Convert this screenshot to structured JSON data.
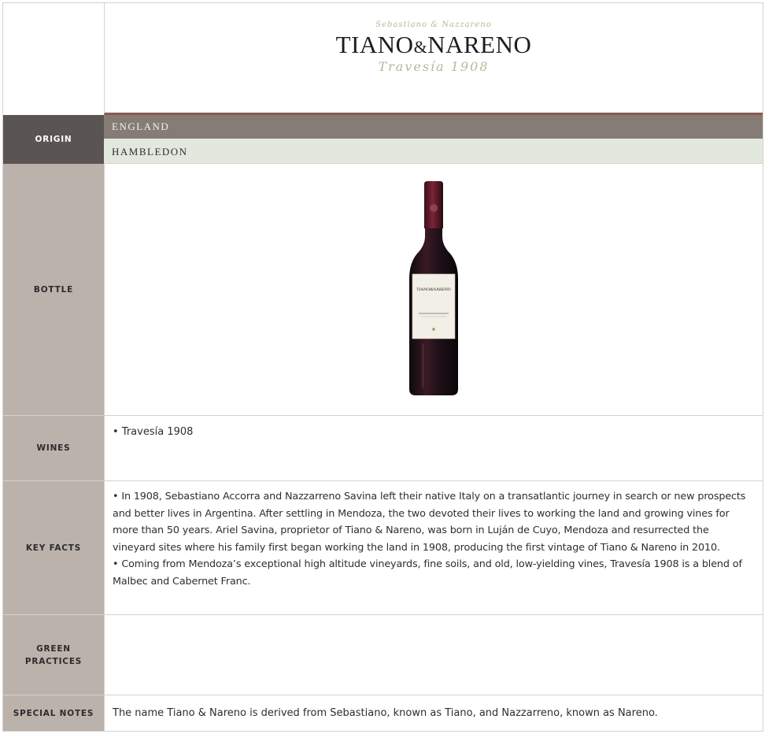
{
  "header": {
    "logo_script_top": "Sebastiano & Nazzareno",
    "logo_brand_left": "TIANO",
    "logo_brand_amp": "&",
    "logo_brand_right": "NARENO",
    "logo_script_bottom": "Travesía 1908"
  },
  "origin": {
    "label": "ORIGIN",
    "country": "ENGLAND",
    "region": "HAMBLEDON"
  },
  "bottle": {
    "label": "BOTTLE",
    "label_text": "TIANO&NARENO"
  },
  "wines": {
    "label": "WINES",
    "items": [
      "• Travesía 1908"
    ]
  },
  "key_facts": {
    "label": "KEY FACTS",
    "items": [
      "• In 1908, Sebastiano Accorra and Nazzarreno Savina left their native Italy on a transatlantic journey in search or new prospects and better lives in Argentina. After settling in Mendoza, the two devoted their lives to working the land and growing vines for more than 50 years. Ariel Savina, proprietor of Tiano & Nareno, was born in Luján de Cuyo, Mendoza and resurrected the vineyard sites where his family first began working the land in 1908, producing the first vintage of Tiano & Nareno in 2010.",
      "• Coming from Mendoza’s exceptional high altitude vineyards, fine soils, and old, low-yielding vines, Travesía 1908 is a blend of Malbec and Cabernet Franc."
    ]
  },
  "green_practices": {
    "label_line1": "GREEN",
    "label_line2": "PRACTICES",
    "text": ""
  },
  "special_notes": {
    "label": "SPECIAL NOTES",
    "text": "The name Tiano & Nareno is derived from Sebastiano, known as Tiano, and Nazzarreno, known as Nareno."
  },
  "colors": {
    "label_bg": "#bcb2ac",
    "origin_label_bg": "#5a5552",
    "country_bar": "#857c76",
    "region_bar": "#e3e8de",
    "accent_rule": "#8a5a52"
  }
}
